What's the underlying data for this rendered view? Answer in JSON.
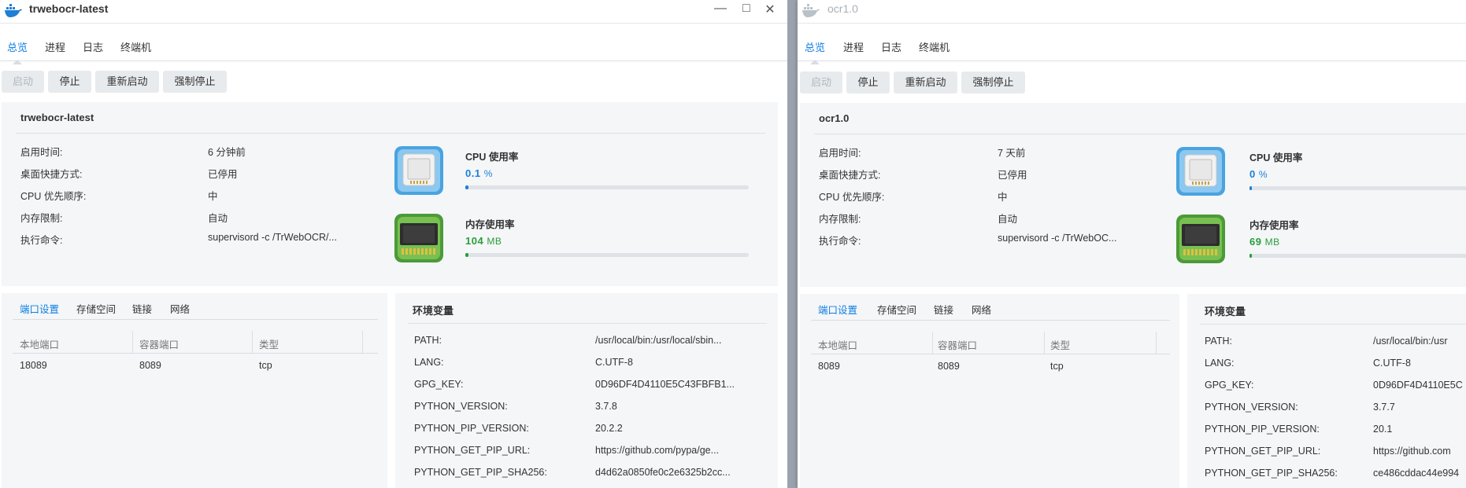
{
  "windowA": {
    "title": "trwebocr-latest",
    "controls": {
      "minimize": "—",
      "maximize": "□",
      "close": "✕"
    },
    "tabs": [
      "总览",
      "进程",
      "日志",
      "终端机"
    ],
    "actions": [
      "启动",
      "停止",
      "重新启动",
      "强制停止"
    ],
    "container_name": "trwebocr-latest",
    "info": [
      {
        "label": "启用时间:",
        "value": "6 分钟前"
      },
      {
        "label": "桌面快捷方式:",
        "value": "已停用"
      },
      {
        "label": "CPU 优先顺序:",
        "value": "中"
      },
      {
        "label": "内存限制:",
        "value": "自动"
      },
      {
        "label": "执行命令:",
        "value": "supervisord -c /TrWebOCR/..."
      }
    ],
    "cpu": {
      "label": "CPU 使用率",
      "value": "0.1",
      "unit": "%",
      "fraction": 0.01
    },
    "mem": {
      "label": "内存使用率",
      "value": "104",
      "unit": "MB",
      "fraction": 0.01
    },
    "subtabs": [
      "端口设置",
      "存储空间",
      "链接",
      "网络"
    ],
    "port_headers": [
      "本地端口",
      "容器端口",
      "类型"
    ],
    "ports": [
      {
        "local": "18089",
        "container": "8089",
        "type": "tcp"
      }
    ],
    "env_title": "环境变量",
    "env": [
      {
        "key": "PATH:",
        "value": "/usr/local/bin:/usr/local/sbin..."
      },
      {
        "key": "LANG:",
        "value": "C.UTF-8"
      },
      {
        "key": "GPG_KEY:",
        "value": "0D96DF4D4110E5C43FBFB1..."
      },
      {
        "key": "PYTHON_VERSION:",
        "value": "3.7.8"
      },
      {
        "key": "PYTHON_PIP_VERSION:",
        "value": "20.2.2"
      },
      {
        "key": "PYTHON_GET_PIP_URL:",
        "value": "https://github.com/pypa/ge..."
      },
      {
        "key": "PYTHON_GET_PIP_SHA256:",
        "value": "d4d62a0850fe0c2e6325b2cc..."
      }
    ]
  },
  "windowB": {
    "title": "ocr1.0",
    "tabs": [
      "总览",
      "进程",
      "日志",
      "终端机"
    ],
    "actions": [
      "启动",
      "停止",
      "重新启动",
      "强制停止"
    ],
    "container_name": "ocr1.0",
    "info": [
      {
        "label": "启用时间:",
        "value": "7 天前"
      },
      {
        "label": "桌面快捷方式:",
        "value": "已停用"
      },
      {
        "label": "CPU 优先顺序:",
        "value": "中"
      },
      {
        "label": "内存限制:",
        "value": "自动"
      },
      {
        "label": "执行命令:",
        "value": "supervisord -c /TrWebOC..."
      }
    ],
    "cpu": {
      "label": "CPU 使用率",
      "value": "0",
      "unit": "%",
      "fraction": 0.01
    },
    "mem": {
      "label": "内存使用率",
      "value": "69",
      "unit": "MB",
      "fraction": 0.01
    },
    "subtabs": [
      "端口设置",
      "存储空间",
      "链接",
      "网络"
    ],
    "port_headers": [
      "本地端口",
      "容器端口",
      "类型"
    ],
    "ports": [
      {
        "local": "8089",
        "container": "8089",
        "type": "tcp"
      }
    ],
    "env_title": "环境变量",
    "env": [
      {
        "key": "PATH:",
        "value": "/usr/local/bin:/usr"
      },
      {
        "key": "LANG:",
        "value": "C.UTF-8"
      },
      {
        "key": "GPG_KEY:",
        "value": "0D96DF4D4110E5C"
      },
      {
        "key": "PYTHON_VERSION:",
        "value": "3.7.7"
      },
      {
        "key": "PYTHON_PIP_VERSION:",
        "value": "20.1"
      },
      {
        "key": "PYTHON_GET_PIP_URL:",
        "value": "https://github.com"
      },
      {
        "key": "PYTHON_GET_PIP_SHA256:",
        "value": "ce486cddac44e994"
      }
    ]
  },
  "colors": {
    "accent": "#0f7fe2",
    "mem_green": "#2a9d3a",
    "cpu_blue": "#1a7fd6"
  },
  "icons": {
    "app": "docker-whale-icon",
    "cpu": "cpu-chip-icon",
    "mem": "memory-module-icon"
  }
}
